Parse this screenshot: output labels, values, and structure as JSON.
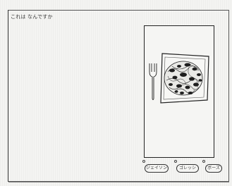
{
  "screen": {
    "title": "これは なんですか"
  },
  "panel": {
    "image": "spaghetti-plate-with-fork"
  },
  "choices": [
    {
      "label": "ジェイソン"
    },
    {
      "label": "ゴレッシ"
    },
    {
      "label": "ボーズ"
    }
  ],
  "colors": {
    "ink": "#222222",
    "paper": "#f4f4f2"
  }
}
